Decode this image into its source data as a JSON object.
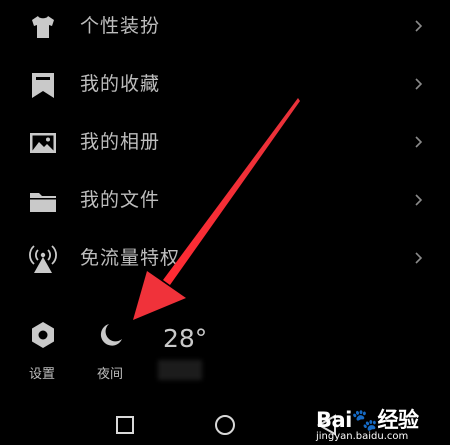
{
  "menu": {
    "items": [
      {
        "label": "个性装扮",
        "icon": "tshirt-icon"
      },
      {
        "label": "我的收藏",
        "icon": "bookmark-icon"
      },
      {
        "label": "我的相册",
        "icon": "photo-icon"
      },
      {
        "label": "我的文件",
        "icon": "folder-icon"
      },
      {
        "label": "免流量特权",
        "icon": "signal-tower-icon"
      }
    ]
  },
  "tools": {
    "settings_label": "设置",
    "night_label": "夜间",
    "temperature": "28°"
  },
  "watermark": {
    "logo_text": "Bai🐾经验",
    "url_text": "jingyan.baidu.com"
  },
  "colors": {
    "background": "#000000",
    "icon_gray": "#c9c9c9",
    "arrow_red": "#f0323a"
  }
}
